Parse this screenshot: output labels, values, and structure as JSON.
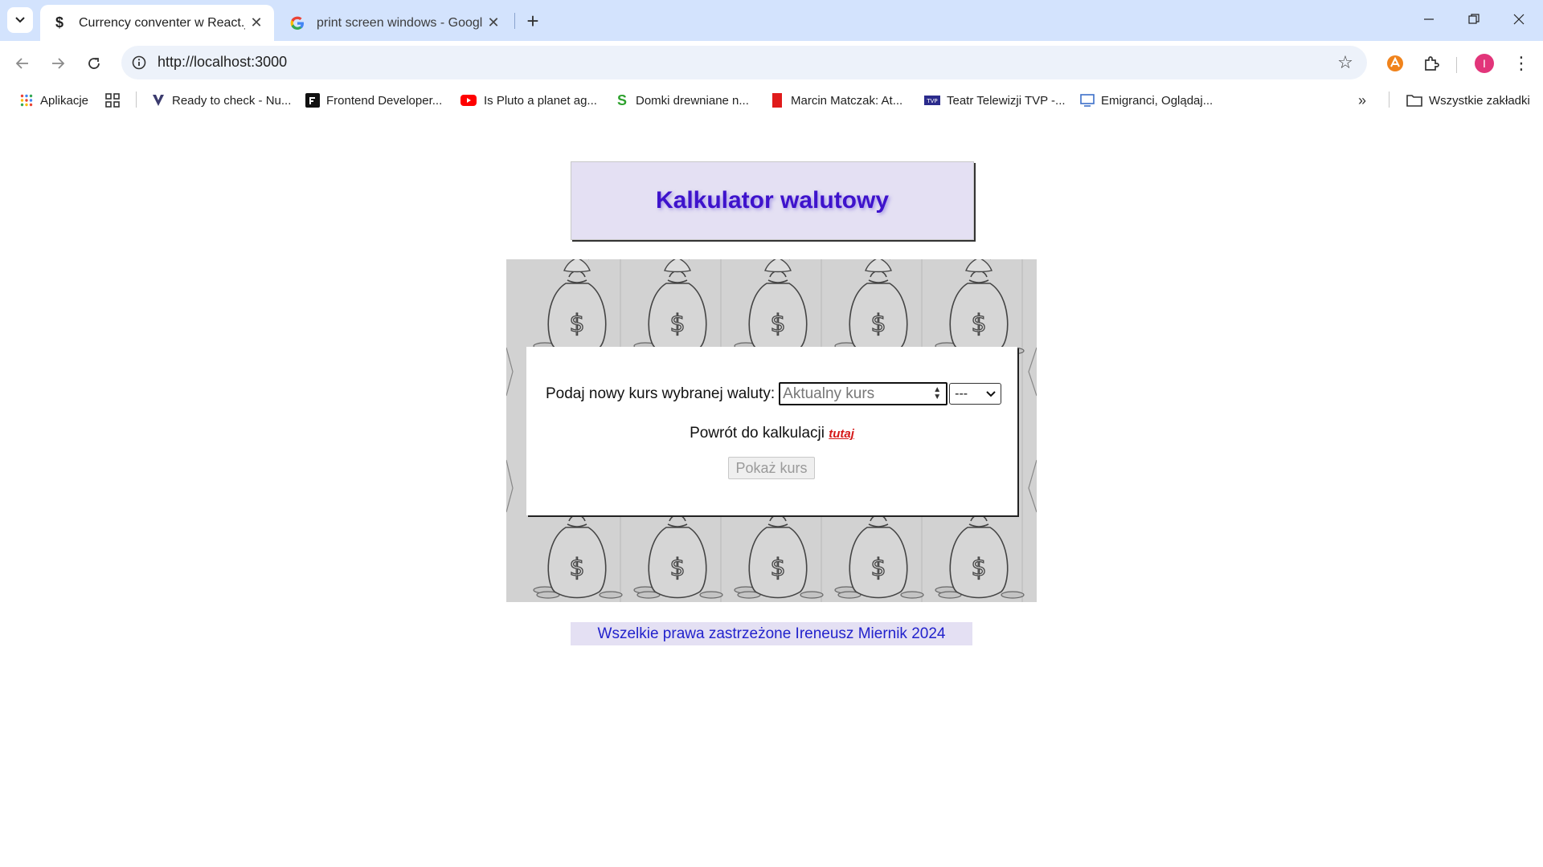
{
  "browser": {
    "tabs": [
      {
        "title": "Currency conventer w React.js",
        "favicon": "$",
        "active": true
      },
      {
        "title": "print screen windows - Google",
        "favicon": "G",
        "active": false
      }
    ],
    "url": "http://localhost:3000",
    "bookmarks": [
      {
        "label": "Aplikacje",
        "icon": "apps-grid-icon"
      },
      {
        "label": "",
        "icon": "grid-icon"
      },
      {
        "label": "Ready to check - Nu...",
        "icon": "shield-icon"
      },
      {
        "label": "Frontend Developer...",
        "icon": "f-logo-icon"
      },
      {
        "label": "Is Pluto a planet ag...",
        "icon": "youtube-icon"
      },
      {
        "label": "Domki drewniane n...",
        "icon": "s-logo-icon"
      },
      {
        "label": "Marcin Matczak: At...",
        "icon": "red-bookmark-icon"
      },
      {
        "label": "Teatr Telewizji TVP -...",
        "icon": "tvp-icon"
      },
      {
        "label": "Emigranci, Oglądaj...",
        "icon": "vod-icon"
      }
    ],
    "all_bookmarks_label": "Wszystkie zakładki",
    "profile_initial": "I"
  },
  "page": {
    "header_title": "Kalkulator walutowy",
    "form_label": "Podaj nowy kurs wybranej waluty:",
    "rate_placeholder": "Aktualny kurs",
    "currency_selected": "---",
    "back_text": "Powrót do kalkulacji",
    "back_link": "tutaj",
    "show_button": "Pokaż kurs",
    "footer_text": "Wszelkie prawa zastrzeżone Ireneusz Miernik 2024"
  },
  "colors": {
    "header_bg": "#e4e0f3",
    "header_text": "#3e13cc",
    "link": "#d51919",
    "footer_text": "#2222cc",
    "tabstrip": "#d3e3fd"
  }
}
